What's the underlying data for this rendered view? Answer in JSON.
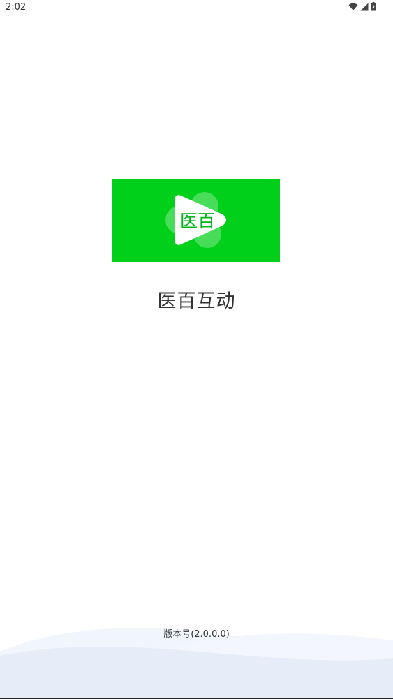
{
  "status_bar": {
    "time": "2:02",
    "icons": [
      "wifi-icon",
      "cellular-signal-icon",
      "battery-icon"
    ]
  },
  "splash": {
    "logo_text": "医百",
    "logo_color": "#00d01a",
    "app_name": "医百互动",
    "version": "版本号(2.0.0.0)"
  }
}
